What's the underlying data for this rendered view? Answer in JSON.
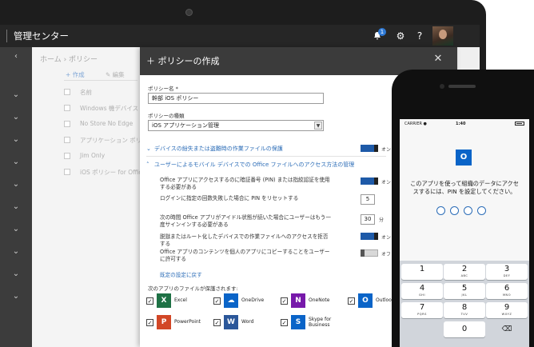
{
  "topbar": {
    "brand": "管理センター",
    "notif_count": "1",
    "bell_glyph": "🔔",
    "gear_glyph": "⚙",
    "help_glyph": "?"
  },
  "background_page": {
    "breadcrumb": "ホーム › ポリシー",
    "create_label": "+ 作成",
    "edit_label": "✎ 編集",
    "rows": [
      "名前",
      "Windows 機デバイス ポ...",
      "No Store No Edge",
      "アプリケーション ポリシー f...",
      "Jim Only",
      "iOS ポリシー for Office..."
    ]
  },
  "panel": {
    "title": "＋ ポリシーの作成",
    "close_glyph": "✕",
    "policy_name_label": "ポリシー名 *",
    "policy_name_value": "幹部 iOS ポリシー",
    "policy_type_label": "ポリシーの種類",
    "policy_type_value": "iOS アプリケーション管理",
    "section1": "デバイスの紛失または盗難時の作業ファイルの保護",
    "section1_toggle": "オン",
    "section2": "ユーザーによるモバイル デバイスでの Office ファイルへのアクセス方法の管理",
    "settings": [
      {
        "text": "Office アプリにアクセスするのに暗証番号 (PIN) または指紋認証を使用する必要がある",
        "toggle": "オン"
      },
      {
        "text": "ログインに指定の回数失敗した場合に PIN をリセットする",
        "value": "5"
      },
      {
        "text": "次の時間 Office アプリがアイドル状態が続いた場合にユーザーはもう一度サインインする必要がある",
        "value": "30",
        "unit": "分"
      },
      {
        "text": "脱獄またはルート化したデバイスでの作業ファイルへのアクセスを拒否する",
        "toggle": "オン"
      },
      {
        "text": "Office アプリのコンテンツを個人のアプリにコピーすることをユーザーに許可する",
        "toggle": "オフ"
      }
    ],
    "reset_link": "既定の設定に戻す",
    "apps_title": "次のアプリのファイルが保護されます:",
    "apps": [
      {
        "name": "Excel",
        "letter": "X",
        "color": "#1e7145"
      },
      {
        "name": "OneDrive",
        "letter": "☁",
        "color": "#0a64c8"
      },
      {
        "name": "OneNote",
        "letter": "N",
        "color": "#7719aa"
      },
      {
        "name": "Outlook",
        "letter": "O",
        "color": "#0a64c8"
      },
      {
        "name": "PowerPoint",
        "letter": "P",
        "color": "#d24726"
      },
      {
        "name": "Word",
        "letter": "W",
        "color": "#2b579a"
      },
      {
        "name": "Skype for Business",
        "letter": "S",
        "color": "#0a64c8"
      }
    ]
  },
  "phone": {
    "carrier": "CARRIER ●",
    "time": "1:40",
    "app_icon": "O",
    "message": "このアプリを使って組織のデータにアクセスするには、PIN を設定してください。",
    "keys": [
      {
        "d": "1",
        "s": ""
      },
      {
        "d": "2",
        "s": "ABC"
      },
      {
        "d": "3",
        "s": "DEF"
      },
      {
        "d": "4",
        "s": "GHI"
      },
      {
        "d": "5",
        "s": "JKL"
      },
      {
        "d": "6",
        "s": "MNO"
      },
      {
        "d": "7",
        "s": "PQRS"
      },
      {
        "d": "8",
        "s": "TUV"
      },
      {
        "d": "9",
        "s": "WXYZ"
      }
    ],
    "zero": "0",
    "delete_glyph": "⌫"
  },
  "colors": {
    "accent": "#2b6cb7",
    "toggle_on": "#1e5aa8",
    "header": "#262626"
  }
}
